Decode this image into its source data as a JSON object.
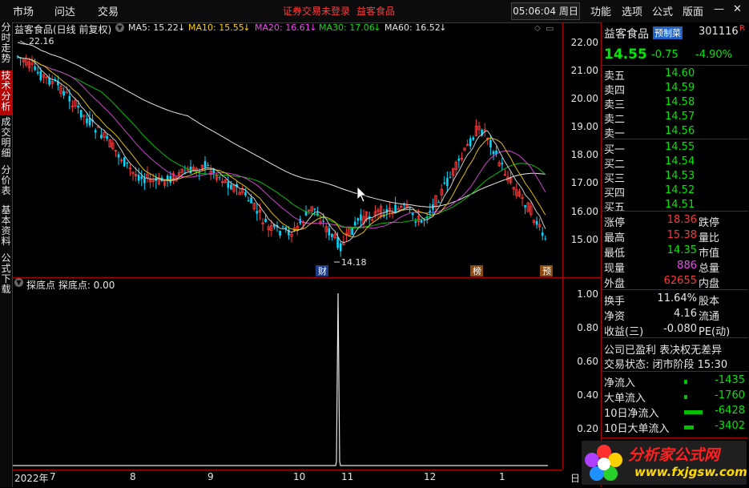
{
  "menu": {
    "items": [
      "市场",
      "问达",
      "交易"
    ],
    "status_text": "证券交易未登录",
    "stock_name": "益客食品",
    "clock": "05:06:04 周日",
    "right_items": [
      "功能",
      "选项",
      "公式",
      "版面"
    ]
  },
  "left_tabs": [
    "分时走势",
    "技术分析",
    "成交明细",
    "分价表",
    "基本资料",
    "公式下载"
  ],
  "chart": {
    "title": "益客食品(日线 前复权)",
    "ma": [
      {
        "label": "MA5: 15.22",
        "color": "#e6e6e6"
      },
      {
        "label": "MA10: 15.55",
        "color": "#ffd200"
      },
      {
        "label": "MA20: 16.61",
        "color": "#ff40ff"
      },
      {
        "label": "MA30: 17.06",
        "color": "#00e600"
      },
      {
        "label": "MA60: 16.52",
        "color": "#e6e6e6"
      }
    ],
    "high_label": "22.16",
    "low_label": "14.18",
    "markers": {
      "cai": "财",
      "bang": "榜",
      "yu": "预"
    },
    "y_ticks": [
      "22.00",
      "21.00",
      "20.00",
      "19.00",
      "18.00",
      "17.00",
      "16.00",
      "15.00"
    ],
    "x_labels": [
      "2022年",
      "7",
      "8",
      "9",
      "10",
      "11",
      "12",
      "1"
    ],
    "x_right": "日"
  },
  "indicator": {
    "title": "探底点 探底点: 0.00",
    "y_ticks": [
      "1.00",
      "0.80",
      "0.60",
      "0.40",
      "0.20"
    ]
  },
  "quote": {
    "name": "益客食品",
    "badge": "预制菜",
    "code": "301116",
    "r_flag": "R",
    "price": "14.55",
    "change": "-0.75",
    "pct": "-4.90%",
    "asks": [
      {
        "label": "卖五",
        "price": "14.60"
      },
      {
        "label": "卖四",
        "price": "14.59"
      },
      {
        "label": "卖三",
        "price": "14.58"
      },
      {
        "label": "卖二",
        "price": "14.57"
      },
      {
        "label": "卖一",
        "price": "14.56"
      }
    ],
    "bids": [
      {
        "label": "买一",
        "price": "14.55"
      },
      {
        "label": "买二",
        "price": "14.54"
      },
      {
        "label": "买三",
        "price": "14.53"
      },
      {
        "label": "买四",
        "price": "14.52"
      },
      {
        "label": "买五",
        "price": "14.51"
      }
    ],
    "stats": [
      {
        "label": "涨停",
        "value": "18.36",
        "label2": "跌停"
      },
      {
        "label": "最高",
        "value": "15.38",
        "label2": "量比"
      },
      {
        "label": "最低",
        "value": "14.35",
        "label2": "市值"
      },
      {
        "label": "现量",
        "value": "886",
        "label2": "总量"
      },
      {
        "label": "外盘",
        "value": "62655",
        "label2": "内盘"
      }
    ],
    "stats2": [
      {
        "label": "换手",
        "value": "11.64%",
        "label2": "股本"
      },
      {
        "label": "净资",
        "value": "4.16",
        "label2": "流通"
      },
      {
        "label": "收益(三)",
        "value": "-0.080",
        "label2": "PE(动)"
      }
    ],
    "company_line": "公司已盈利 表决权无差异",
    "trade_state": "交易状态: 闭市阶段 15:30",
    "flows": [
      {
        "label": "净流入",
        "value": "-1435",
        "bar": 0.05
      },
      {
        "label": "大单流入",
        "value": "-1760",
        "bar": 0.05
      },
      {
        "label": "10日净流入",
        "value": "-6428",
        "bar": 0.9
      },
      {
        "label": "10日大单流入",
        "value": "-3402",
        "bar": 0.45
      }
    ]
  },
  "logo": {
    "text": "分析家公式网",
    "url": "www.fxjgsw.com"
  }
}
